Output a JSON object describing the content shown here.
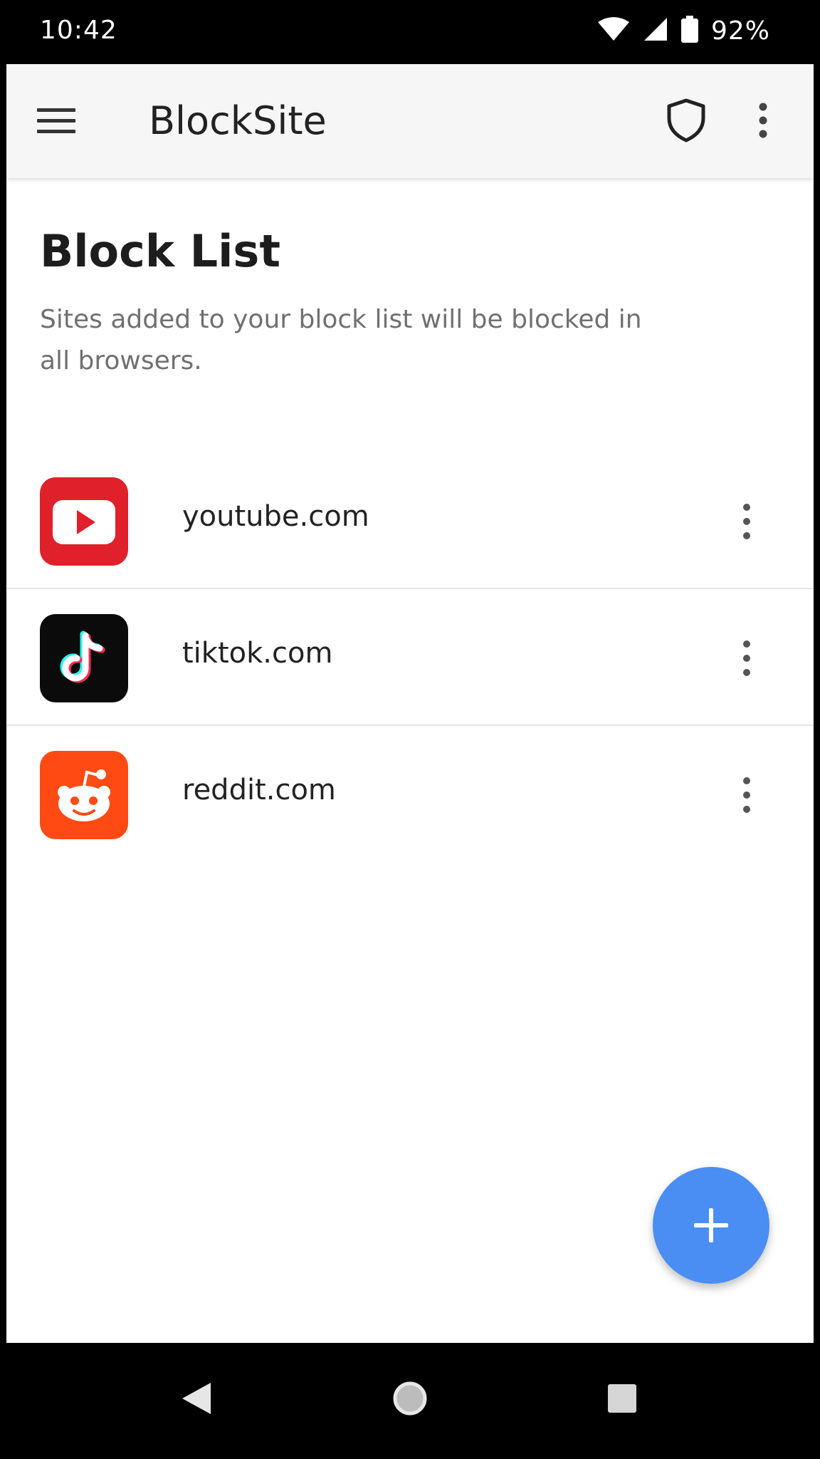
{
  "status_bar": {
    "time": "10:42",
    "battery_percent": "92%",
    "icons": [
      "wifi-icon",
      "cell-signal-icon",
      "battery-icon"
    ]
  },
  "app_bar": {
    "title": "BlockSite",
    "icons": [
      "menu-icon",
      "shield-icon",
      "more-vertical-icon"
    ]
  },
  "page": {
    "title": "Block List",
    "description": "Sites added to your block list will be blocked in all browsers."
  },
  "block_list": {
    "items": [
      {
        "name": "youtube.com",
        "logo": "youtube-logo-icon",
        "color": "#e62117"
      },
      {
        "name": "tiktok.com",
        "logo": "tiktok-logo-icon",
        "color": "#000000"
      },
      {
        "name": "reddit.com",
        "logo": "reddit-logo-icon",
        "color": "#ff4500"
      }
    ]
  },
  "fab": {
    "icon": "plus-icon",
    "color": "#4a8ef3"
  },
  "nav_bar": {
    "icons": [
      "back-icon",
      "home-icon",
      "recents-icon"
    ]
  }
}
